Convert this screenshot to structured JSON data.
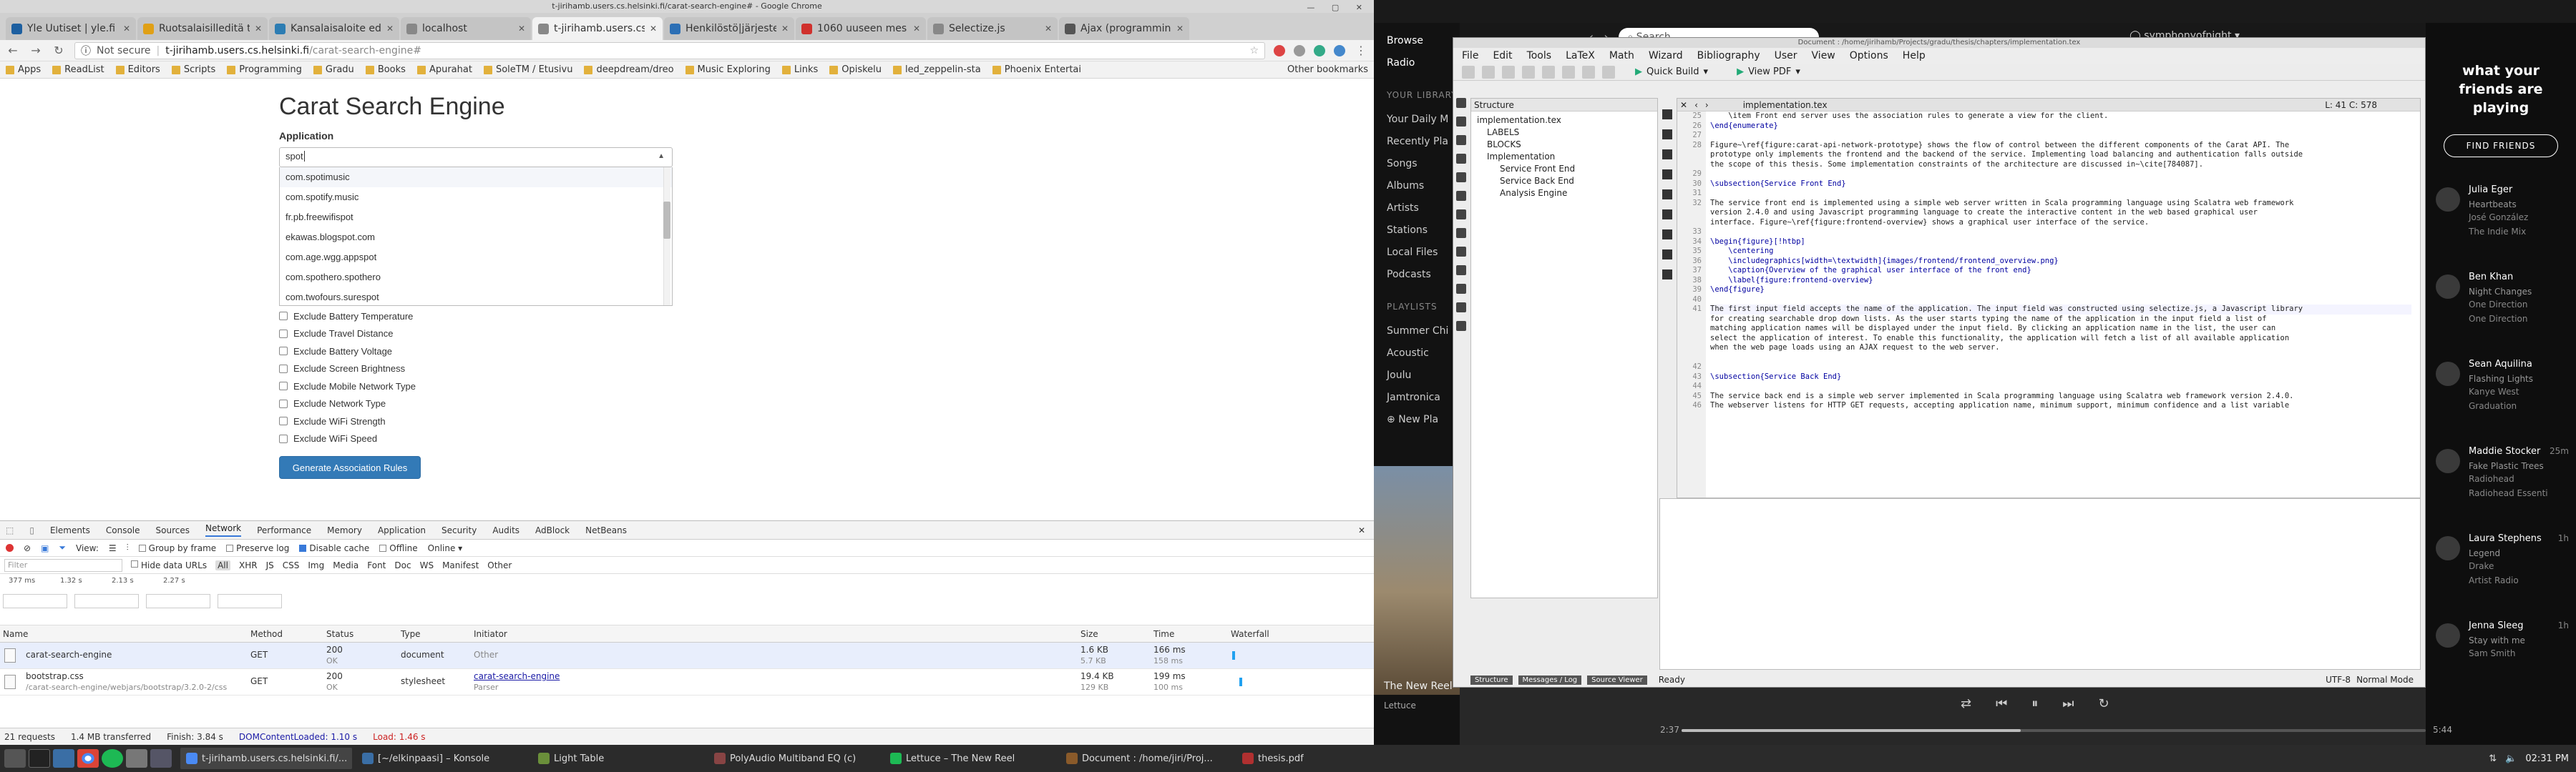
{
  "chrome": {
    "window_title": "t-jirihamb.users.cs.helsinki.fi/carat-search-engine# - Google Chrome",
    "tabs": [
      {
        "label": "Yle Uutiset | yle.fi",
        "color": "#1d5fa0",
        "active": false
      },
      {
        "label": "Ruotsalaisilleditä tä",
        "color": "#e0a016",
        "active": false
      },
      {
        "label": "Kansalaisaloite edu",
        "color": "#2d7db3",
        "active": false
      },
      {
        "label": "localhost",
        "color": "#888888",
        "active": false
      },
      {
        "label": "t-jirihamb.users.cs.h",
        "color": "#888888",
        "active": true
      },
      {
        "label": "Henkilöstö|järjestel",
        "color": "#2c6fb5",
        "active": false
      },
      {
        "label": "1060 uuseen mes",
        "color": "#d0312d",
        "active": false
      },
      {
        "label": "Selectize.js",
        "color": "#888888",
        "active": false
      },
      {
        "label": "Ajax (programmin",
        "color": "#555555",
        "active": false
      }
    ],
    "address": {
      "not_secure": "Not secure",
      "host": "t-jirihamb.users.cs.helsinki.fi",
      "path": "/carat-search-engine#"
    },
    "bookmarks": [
      "Apps",
      "ReadList",
      "Editors",
      "Scripts",
      "Programming",
      "Gradu",
      "Books",
      "Apurahat",
      "SoleTM / Etusivu",
      "deepdream/dreo",
      "Music Exploring",
      "Links",
      "Opiskelu",
      "led_zeppelin-sta",
      "Phoenix Entertai"
    ],
    "other_bookmarks": "Other bookmarks"
  },
  "page": {
    "title": "Carat Search Engine",
    "application_label": "Application",
    "search_value": "spot",
    "dropdown_options": [
      "com.spotimusic",
      "com.spotify.music",
      "fr.pb.freewifispot",
      "ekawas.blogspot.com",
      "com.age.wgg.appspot",
      "com.spothero.spothero",
      "com.twofours.surespot"
    ],
    "checkboxes": [
      "Exclude Battery Temperature",
      "Exclude Travel Distance",
      "Exclude Battery Voltage",
      "Exclude Screen Brightness",
      "Exclude Mobile Network Type",
      "Exclude Network Type",
      "Exclude WiFi Strength",
      "Exclude WiFi Speed"
    ],
    "generate_button": "Generate Association Rules"
  },
  "devtools": {
    "tabs": [
      "Elements",
      "Console",
      "Sources",
      "Network",
      "Performance",
      "Memory",
      "Application",
      "Security",
      "Audits",
      "AdBlock",
      "NetBeans"
    ],
    "active_tab": "Network",
    "toolbar": {
      "view": "View:",
      "group_by_frame": "Group by frame",
      "preserve_log": "Preserve log",
      "disable_cache": "Disable cache",
      "offline": "Offline",
      "throttle": "Online"
    },
    "filter_placeholder": "Filter",
    "filter_types": [
      "Hide data URLs",
      "All",
      "XHR",
      "JS",
      "CSS",
      "Img",
      "Media",
      "Font",
      "Doc",
      "WS",
      "Manifest",
      "Other"
    ],
    "overview_ticks": [
      "377 ms",
      "1.32 s",
      "2.13 s",
      "2.27 s"
    ],
    "columns": [
      "Name",
      "Method",
      "Status",
      "Type",
      "Initiator",
      "Size",
      "Time",
      "Waterfall"
    ],
    "rows": [
      {
        "name": "carat-search-engine",
        "sub": "",
        "method": "GET",
        "status": "200",
        "status_sub": "OK",
        "type": "document",
        "initiator": "Other",
        "initiator_sub": "",
        "size": "1.6 KB",
        "size_sub": "5.7 KB",
        "time": "166 ms",
        "time_sub": "158 ms"
      },
      {
        "name": "bootstrap.css",
        "sub": "/carat-search-engine/webjars/bootstrap/3.2.0-2/css",
        "method": "GET",
        "status": "200",
        "status_sub": "OK",
        "type": "stylesheet",
        "initiator": "carat-search-engine",
        "initiator_sub": "Parser",
        "size": "19.4 KB",
        "size_sub": "129 KB",
        "time": "199 ms",
        "time_sub": "100 ms"
      }
    ],
    "status": {
      "requests": "21 requests",
      "transferred": "1.4 MB transferred",
      "finish": "Finish: 3.84 s",
      "dcl": "DOMContentLoaded: 1.10 s",
      "load": "Load: 1.46 s"
    }
  },
  "spotify": {
    "nav": [
      "Browse",
      "Radio"
    ],
    "library_items": [
      "Your Daily M",
      "Recently Pla",
      "Songs",
      "Albums",
      "Artists",
      "Stations",
      "Local Files",
      "Podcasts"
    ],
    "playlists_head": "PLAYLISTS",
    "playlists": [
      "Summer Chi",
      "Acoustic",
      "Joulu",
      "Jamtronica"
    ],
    "new_playlist": "New Pla",
    "search_placeholder": "Search",
    "user": "symphonyofnight",
    "friends_heading": "what your friends are playing",
    "find_friends": "FIND FRIENDS",
    "friends": [
      {
        "name": "Julia Eger",
        "track": "Heartbeats",
        "artist": "José González",
        "context": "The Indie Mix",
        "ago": ""
      },
      {
        "name": "Ben Khan",
        "track": "Night Changes",
        "artist": "One Direction",
        "context": "One Direction",
        "ago": ""
      },
      {
        "name": "Sean Aquilina",
        "track": "Flashing Lights",
        "artist": "Kanye West",
        "context": "Graduation",
        "ago": ""
      },
      {
        "name": "Maddie Stocker",
        "track": "Fake Plastic Trees",
        "artist": "Radiohead",
        "context": "Radiohead Essenti",
        "ago": "25m"
      },
      {
        "name": "Laura Stephens",
        "track": "Legend",
        "artist": "Drake",
        "context": "Artist Radio",
        "ago": "1h"
      },
      {
        "name": "Jenna Sleeg",
        "track": "Stay with me",
        "artist": "Sam Smith",
        "context": "",
        "ago": "1h"
      }
    ],
    "now_playing": {
      "title": "The New Reel",
      "artist": "Lettuce",
      "elapsed": "2:37",
      "duration": "5:44",
      "progress": 0.456
    }
  },
  "texmaker": {
    "window_title": "Document : /home/jirihamb/Projects/gradu/thesis/chapters/implementation.tex",
    "menu": [
      "File",
      "Edit",
      "Tools",
      "LaTeX",
      "Math",
      "Wizard",
      "Bibliography",
      "User",
      "View",
      "Options",
      "Help"
    ],
    "quick_build": "Quick Build",
    "view_pdf": "View PDF",
    "structure_head": "Structure",
    "structure": [
      "implementation.tex",
      "LABELS",
      "BLOCKS",
      "Implementation",
      "Service Front End",
      "Service Back End",
      "Analysis Engine"
    ],
    "file_name": "implementation.tex",
    "line_col": "L: 41 C: 578",
    "line_numbers": [
      "25",
      "26",
      "27",
      "28",
      "",
      "",
      "29",
      "30",
      "31",
      "32",
      "",
      "",
      "33",
      "34",
      "35",
      "36",
      "37",
      "38",
      "39",
      "40",
      "41",
      "",
      "",
      "",
      "",
      "",
      "42",
      "43",
      "44",
      "45",
      "46",
      ""
    ],
    "code_lines": [
      "    \\item Front end server uses the association rules to generate a view for the client.",
      "\\end{enumerate}",
      "",
      "Figure~\\ref{figure:carat-api-network-prototype} shows the flow of control between the different components of the Carat API. The",
      "prototype only implements the frontend and the backend of the service. Implementing load balancing and authentication falls outside",
      "the scope of this thesis. Some implementation constraints of the architecture are discussed in~\\cite[784087].",
      "",
      "\\subsection{Service Front End}",
      "",
      "The service front end is implemented using a simple web server written in Scala programming language using Scalatra web framework",
      "version 2.4.0 and using Javascript programming language to create the interactive content in the web based graphical user",
      "interface. Figure~\\ref{figure:frontend-overview} shows a graphical user interface of the service.",
      "",
      "\\begin{figure}[!htbp]",
      "    \\centering",
      "    \\includegraphics[width=\\textwidth]{images/frontend/frontend_overview.png}",
      "    \\caption{Overview of the graphical user interface of the front end}",
      "    \\label{figure:frontend-overview}",
      "\\end{figure}",
      "",
      "The first input field accepts the name of the application. The input field was constructed using selectize.js, a Javascript library",
      "for creating searchable drop down lists. As the user starts typing the name of the application in the input field a list of",
      "matching application names will be displayed under the input field. By clicking an application name in the list, the user can",
      "select the application of interest. To enable this functionality, the application will fetch a list of all available application",
      "when the web page loads using an AJAX request to the web server.",
      "",
      "",
      "\\subsection{Service Back End}",
      "",
      "The service back end is a simple web server implemented in Scala programming language using Scalatra web framework version 2.4.0.",
      "The webserver listens for HTTP GET requests, accepting application name, minimum support, minimum confidence and a list variable"
    ],
    "status": {
      "structure_btn": "Structure",
      "messages_btn": "Messages / Log",
      "source_btn": "Source Viewer",
      "ready": "Ready",
      "encoding": "UTF-8",
      "mode": "Normal Mode"
    }
  },
  "taskbar": {
    "windows": [
      {
        "label": "t-jirihamb.users.cs.helsinki.fi/...",
        "color": "#4a8af4",
        "active": true
      },
      {
        "label": "[~/elkinpaasi] – Konsole",
        "color": "#3a6ea5",
        "active": false
      },
      {
        "label": "Light Table",
        "color": "#6a8f3a",
        "active": false
      },
      {
        "label": "PolyAudio Multiband EQ (c)",
        "color": "#884444",
        "active": false
      },
      {
        "label": "Lettuce – The New Reel",
        "color": "#1db954",
        "active": false
      },
      {
        "label": "Document : /home/jiri/Proj...",
        "color": "#8a5a2a",
        "active": false
      },
      {
        "label": "thesis.pdf",
        "color": "#b03030",
        "active": false
      }
    ],
    "clock": "02:31 PM"
  }
}
